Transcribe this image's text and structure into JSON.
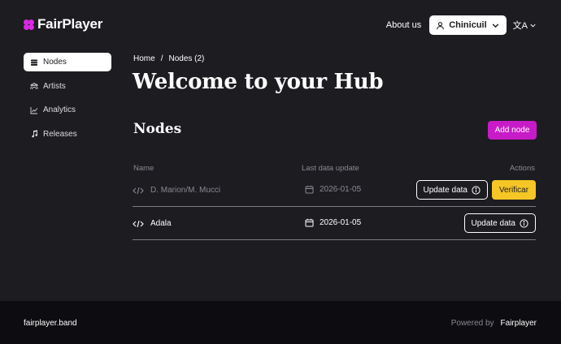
{
  "header": {
    "brand": "FairPlayer",
    "about_label": "About us",
    "user_label": "Chinicuil",
    "lang_label": "文A"
  },
  "sidebar": {
    "items": [
      {
        "label": "Nodes",
        "icon": "stack-icon",
        "active": true
      },
      {
        "label": "Artists",
        "icon": "users-icon",
        "active": false
      },
      {
        "label": "Analytics",
        "icon": "chart-icon",
        "active": false
      },
      {
        "label": "Releases",
        "icon": "music-note-icon",
        "active": false
      }
    ]
  },
  "breadcrumb": {
    "home": "Home",
    "separator": "/",
    "current": "Nodes (2)"
  },
  "main": {
    "title": "Welcome to your Hub",
    "section_title": "Nodes",
    "add_button": "Add node"
  },
  "table": {
    "headers": {
      "name": "Name",
      "date": "Last data update",
      "actions": "Actions"
    },
    "rows": [
      {
        "name": "D. Marion/M. Mucci",
        "date": "2026-01-05",
        "update_label": "Update data",
        "verify_label": "Verificar",
        "dimmed": true
      },
      {
        "name": "Adala",
        "date": "2026-01-05",
        "update_label": "Update data",
        "dimmed": false
      }
    ]
  },
  "footer": {
    "domain": "fairplayer.band",
    "powered_by": "Powered by",
    "brand": "Fairplayer"
  },
  "colors": {
    "background": "#1d1c21",
    "accent": "#c81bc8",
    "verify": "#f5c625",
    "footer": "#0d0c10"
  }
}
